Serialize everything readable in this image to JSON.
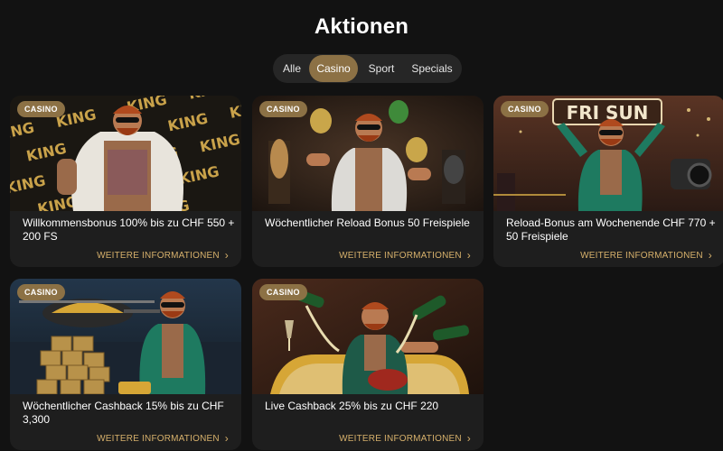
{
  "page": {
    "title": "Aktionen"
  },
  "tabs": [
    {
      "label": "Alle",
      "active": false
    },
    {
      "label": "Casino",
      "active": true
    },
    {
      "label": "Sport",
      "active": false
    },
    {
      "label": "Specials",
      "active": false
    }
  ],
  "cards": [
    {
      "badge": "CASINO",
      "title": "Willkommensbonus 100% bis zu CHF 550 + 200 FS",
      "link": "WEITERE INFORMATIONEN",
      "image_text": "KING"
    },
    {
      "badge": "CASINO",
      "title": "Wöchentlicher Reload Bonus 50 Freispiele",
      "link": "WEITERE INFORMATIONEN"
    },
    {
      "badge": "CASINO",
      "title": "Reload-Bonus am Wochenende CHF 770 + 50 Freispiele",
      "link": "WEITERE INFORMATIONEN",
      "image_text": "FRI SUN"
    },
    {
      "badge": "CASINO",
      "title": "Wöchentlicher Cashback 15% bis zu CHF 3,300",
      "link": "WEITERE INFORMATIONEN"
    },
    {
      "badge": "CASINO",
      "title": "Live Cashback 25% bis zu CHF 220",
      "link": "WEITERE INFORMATIONEN"
    }
  ],
  "colors": {
    "background": "#121212",
    "card": "#1e1e1e",
    "accent": "#8c7145",
    "link": "#d6b06b"
  },
  "icons": {
    "card_link": "chevron-right-icon"
  }
}
